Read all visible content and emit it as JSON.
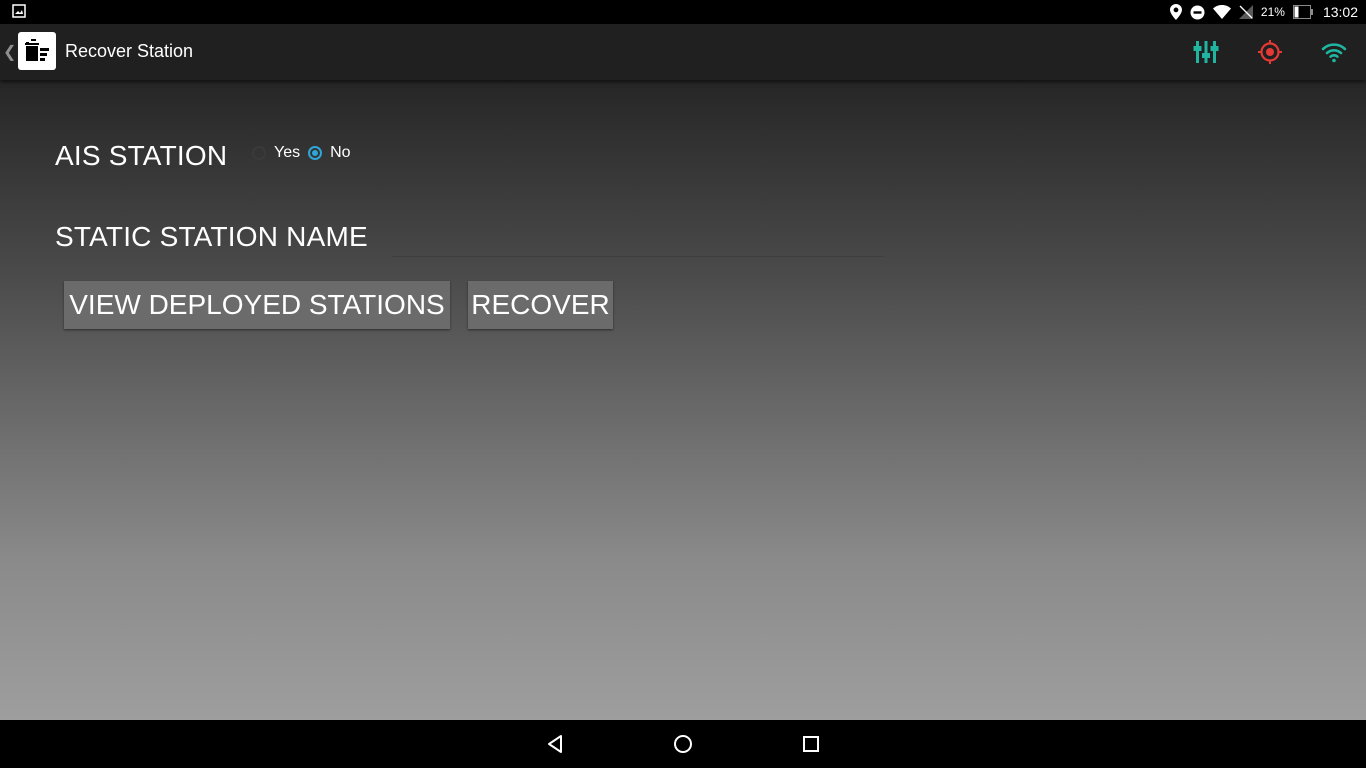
{
  "status_bar": {
    "battery_percent": "21%",
    "clock": "13:02",
    "icons": [
      "image-icon",
      "location-icon",
      "do-not-disturb-icon",
      "wifi-icon",
      "no-signal-icon",
      "battery-icon"
    ]
  },
  "action_bar": {
    "title": "Recover Station",
    "app_icon": "recover-station-app-icon",
    "actions": [
      "equalizer-icon",
      "gps-target-icon",
      "wifi-icon"
    ],
    "colors": {
      "equalizer": "#1fb5a0",
      "gps_target": "#e53935",
      "wifi": "#1fb5a0"
    }
  },
  "form": {
    "ais_label": "AIS STATION",
    "radio_yes": "Yes",
    "radio_no": "No",
    "selected": "No",
    "static_name_label": "STATIC STATION NAME",
    "static_name_value": "",
    "view_deployed_button": "VIEW DEPLOYED STATIONS",
    "recover_button": "RECOVER"
  },
  "nav_bar": {
    "icons": [
      "back-icon",
      "home-icon",
      "recents-icon"
    ]
  }
}
